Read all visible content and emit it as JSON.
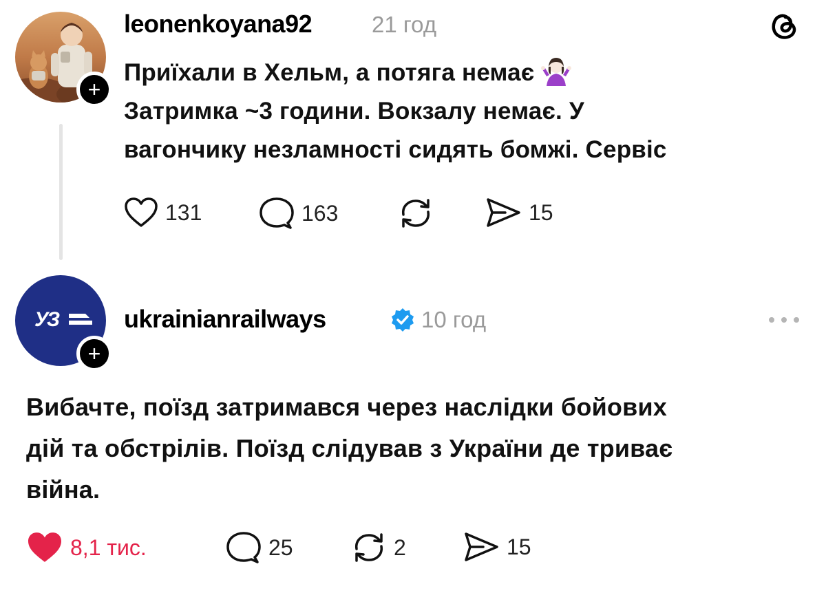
{
  "post": {
    "username": "leonenkoyana92",
    "time": "21 год",
    "lines": [
      "Приїхали в Хельм, а потяга немає",
      "Затримка ~3 години. Вокзалу немає. У",
      "вагончику незламності сидять бомжі. Сервіс"
    ],
    "emoji_icon": "person-shrugging-emoji",
    "actions": {
      "likes": "131",
      "comments": "163",
      "reposts": "",
      "shares": "15"
    }
  },
  "reply": {
    "username": "ukrainianrailways",
    "verified_icon": "verified-badge-icon",
    "time": "10 год",
    "avatar_logo_text": "УЗ",
    "lines": [
      "Вибачте, поїзд затримався через наслідки бойових",
      "дій та обстрілів. Поїзд слідував з України де триває",
      "війна."
    ],
    "actions": {
      "likes": "8,1 тис.",
      "comments": "25",
      "reposts": "2",
      "shares": "15"
    }
  },
  "icons": {
    "app_logo": "threads-logo-icon",
    "more": "more-options-icon",
    "follow": "follow-plus-icon",
    "like": "heart-icon",
    "comment": "comment-bubble-icon",
    "repost": "repost-icon",
    "share": "share-icon"
  },
  "colors": {
    "liked": "#e4234a",
    "verified": "#1d9bf0",
    "railways_blue": "#1f2f86",
    "muted": "#9a9a9a"
  }
}
